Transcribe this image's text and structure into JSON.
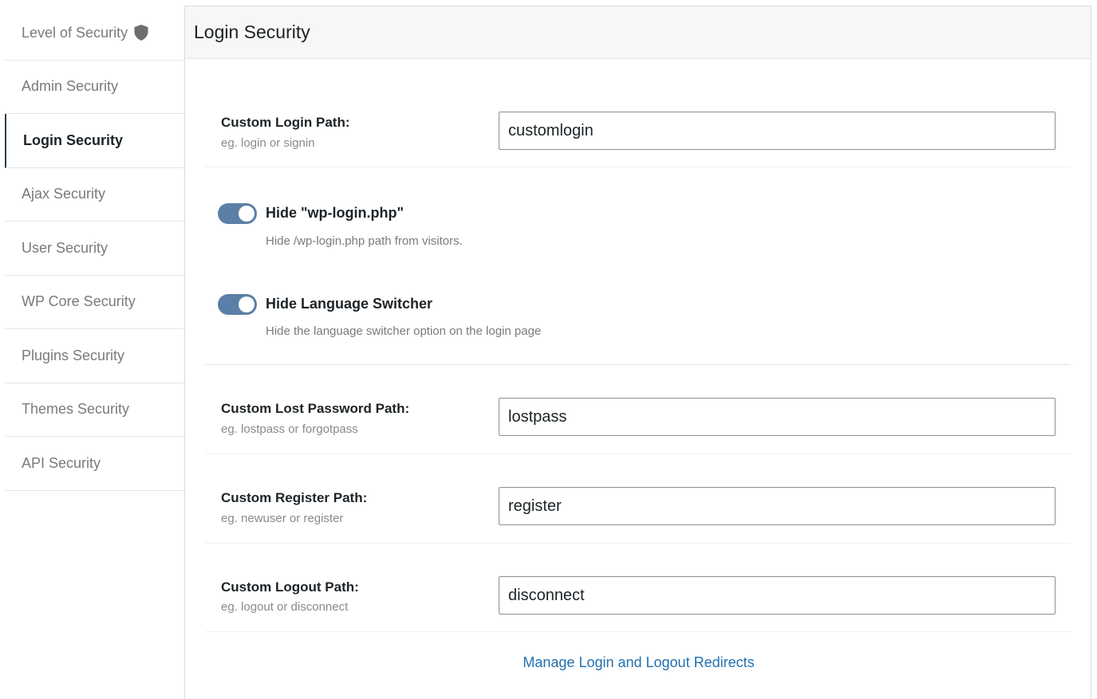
{
  "sidebar": {
    "items": [
      {
        "label": "Level of Security",
        "icon": "shield-icon"
      },
      {
        "label": "Admin Security"
      },
      {
        "label": "Login Security",
        "active": true
      },
      {
        "label": "Ajax Security"
      },
      {
        "label": "User Security"
      },
      {
        "label": "WP Core Security"
      },
      {
        "label": "Plugins Security"
      },
      {
        "label": "Themes Security"
      },
      {
        "label": "API Security"
      }
    ]
  },
  "panel": {
    "title": "Login Security"
  },
  "fields": {
    "login_path": {
      "label": "Custom Login Path:",
      "hint": "eg. login or signin",
      "value": "customlogin"
    },
    "lost_password_path": {
      "label": "Custom Lost Password Path:",
      "hint": "eg. lostpass or forgotpass",
      "value": "lostpass"
    },
    "register_path": {
      "label": "Custom Register Path:",
      "hint": "eg. newuser or register",
      "value": "register"
    },
    "logout_path": {
      "label": "Custom Logout Path:",
      "hint": "eg. logout or disconnect",
      "value": "disconnect"
    }
  },
  "toggles": {
    "hide_wp_login": {
      "title": "Hide \"wp-login.php\"",
      "description": "Hide /wp-login.php path from visitors.",
      "enabled": true
    },
    "hide_language_switcher": {
      "title": "Hide Language Switcher",
      "description": "Hide the language switcher option on the login page",
      "enabled": true
    }
  },
  "links": {
    "redirects": "Manage Login and Logout Redirects"
  },
  "colors": {
    "toggle_on": "#5b7fa6",
    "link": "#2271b1",
    "shield": "#6e6e6e"
  }
}
